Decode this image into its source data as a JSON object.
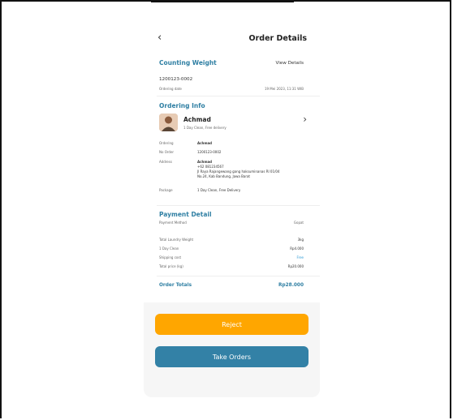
{
  "header": {
    "back_icon": "‹",
    "title": "Order Details"
  },
  "counting": {
    "title": "Counting Weight",
    "view_details": "View Details",
    "order_number": "1200123-0002",
    "ordering_date_label": "Ordering date",
    "ordering_date_value": "19 Mei 2023, 11:31 WIB"
  },
  "ordering_info": {
    "title": "Ordering Info",
    "customer_name": "Achmad",
    "service": "1 Day Clean, Free delivery",
    "rows": [
      {
        "label": "Ordering",
        "value": "Achmad"
      },
      {
        "label": "No Order",
        "value": "1200123-0002"
      },
      {
        "label": "Address",
        "value_name": "Achmad",
        "value_phone": "+62 081234567",
        "value_addr1": "Jl Raya Rajangewang gang haksuminanas RI 01/04",
        "value_addr2": "No.24, Kab Bandung, Jawa Barat"
      },
      {
        "label": "Package",
        "value": "1 Day Clean, Free Delivery"
      }
    ]
  },
  "payment": {
    "title": "Payment Detail",
    "method_label": "Payment Method",
    "method_value": "Gopat",
    "rows": [
      {
        "label": "Total Laundry Weight",
        "value": "3kg"
      },
      {
        "label": "1 Day Clean",
        "value": "Rp4.000"
      },
      {
        "label": "Shipping cost",
        "value": "Free"
      },
      {
        "label": "Total price (kg)",
        "value": "Rp20.000"
      }
    ],
    "total_label": "Order Totals",
    "total_value": "Rp28.000"
  },
  "actions": {
    "reject": "Reject",
    "take": "Take Orders"
  },
  "colors": {
    "accent": "#2f7fa3",
    "reject": "#ffa600",
    "take": "#3381a6",
    "free": "#2e9bd6"
  }
}
